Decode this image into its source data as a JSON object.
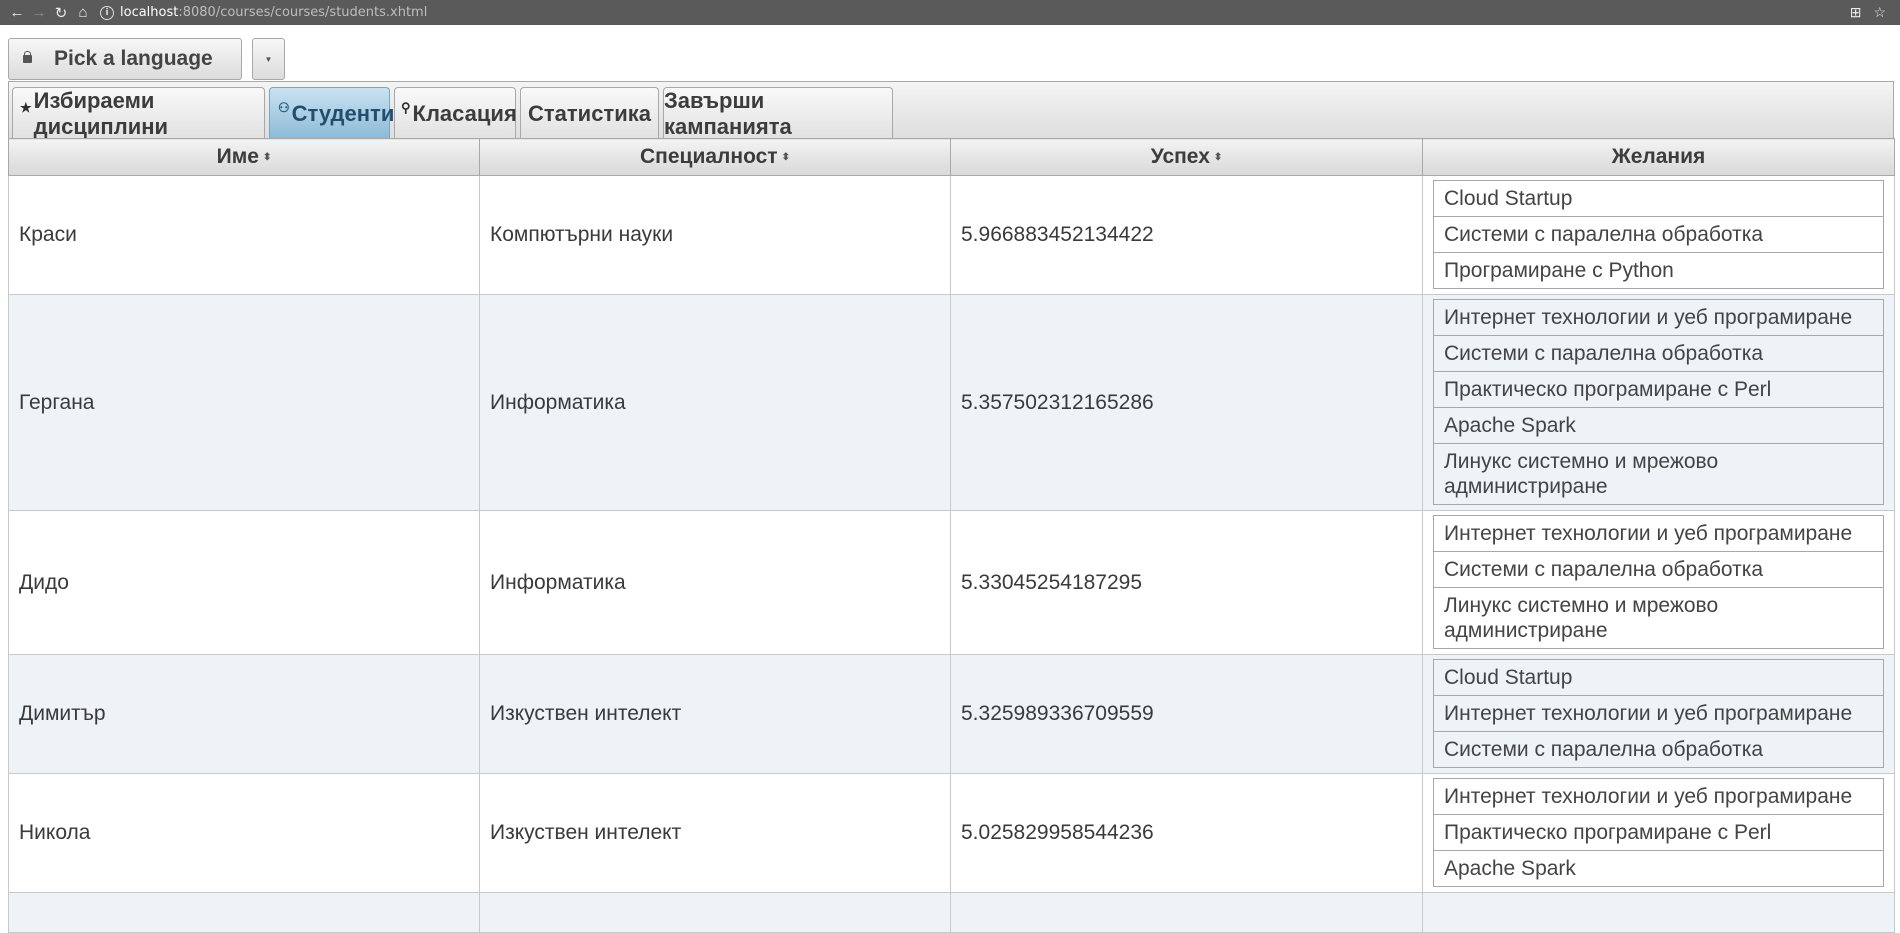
{
  "browser": {
    "url_host": "localhost",
    "url_rest": ":8080/courses/courses/students.xhtml"
  },
  "language_button": {
    "label": "Pick a language"
  },
  "tabs": [
    {
      "label": "Избираеми дисциплини",
      "icon": "star-icon",
      "glyph": "★"
    },
    {
      "label": "Студенти",
      "icon": "person-icon",
      "glyph": "⚲"
    },
    {
      "label": "Класация",
      "icon": "search-icon",
      "glyph": "⚲"
    },
    {
      "label": "Статистика"
    },
    {
      "label": "Завърши кампанията"
    }
  ],
  "table": {
    "headers": [
      "Име",
      "Специалност",
      "Успех",
      "Желания"
    ],
    "rows": [
      {
        "name": "Краси",
        "specialty": "Компютърни науки",
        "grade": "5.966883452134422",
        "wishes": [
          "Cloud Startup",
          "Системи с паралелна обработка",
          "Програмиране с Python"
        ]
      },
      {
        "name": "Гергана",
        "specialty": "Информатика",
        "grade": "5.357502312165286",
        "wishes": [
          "Интернет технологии и уеб програмиране",
          "Системи с паралелна обработка",
          "Практическо програмиране с Perl",
          "Apache Spark",
          "Линукс системно и мрежово администриране"
        ]
      },
      {
        "name": "Дидо",
        "specialty": "Информатика",
        "grade": "5.33045254187295",
        "wishes": [
          "Интернет технологии и уеб програмиране",
          "Системи с паралелна обработка",
          "Линукс системно и мрежово администриране"
        ]
      },
      {
        "name": "Димитър",
        "specialty": "Изкуствен интелект",
        "grade": "5.325989336709559",
        "wishes": [
          "Cloud Startup",
          "Интернет технологии и уеб програмиране",
          "Системи с паралелна обработка"
        ]
      },
      {
        "name": "Никола",
        "specialty": "Изкуствен интелект",
        "grade": "5.025829958544236",
        "wishes": [
          "Интернет технологии и уеб програмиране",
          "Практическо програмиране с Perl",
          "Apache Spark"
        ]
      }
    ]
  }
}
